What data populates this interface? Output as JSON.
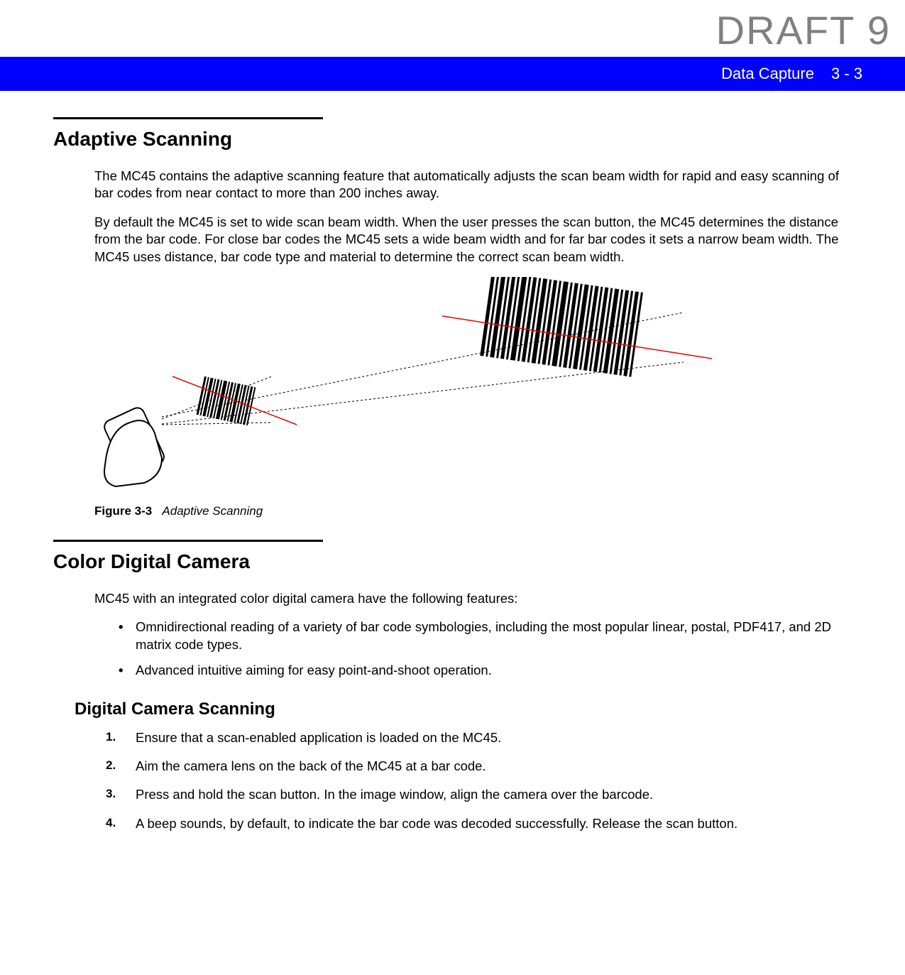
{
  "watermark": "DRAFT 9",
  "header": {
    "chapter": "Data Capture",
    "page": "3 - 3"
  },
  "sections": {
    "adaptive": {
      "title": "Adaptive Scanning",
      "p1": "The MC45 contains the adaptive scanning feature that automatically adjusts the scan beam width for rapid and easy scanning of bar codes from near contact to more than 200 inches away.",
      "p2": "By default the MC45 is set to wide scan beam width. When the user presses the scan button, the MC45 determines the distance from the bar code. For close bar codes the MC45 sets a wide beam width and for far bar codes it sets a narrow beam width. The MC45 uses distance, bar code type and material to determine the correct scan beam width.",
      "figure": {
        "label": "Figure 3-3",
        "caption": "Adaptive Scanning"
      }
    },
    "camera": {
      "title": "Color Digital Camera",
      "intro": "MC45 with an integrated color digital camera have the following features:",
      "bullets": [
        "Omnidirectional reading of a variety of bar code symbologies, including the most popular linear, postal, PDF417, and 2D matrix code types.",
        "Advanced intuitive aiming for easy point-and-shoot operation."
      ],
      "subsection": {
        "title": "Digital Camera Scanning",
        "steps": [
          "Ensure that a scan-enabled application is loaded on the MC45.",
          "Aim the camera lens on the back of the MC45 at a bar code.",
          "Press and hold the scan button. In the image window, align the camera over the barcode.",
          "A beep sounds, by default, to indicate the bar code was decoded successfully. Release the scan button."
        ]
      }
    }
  }
}
